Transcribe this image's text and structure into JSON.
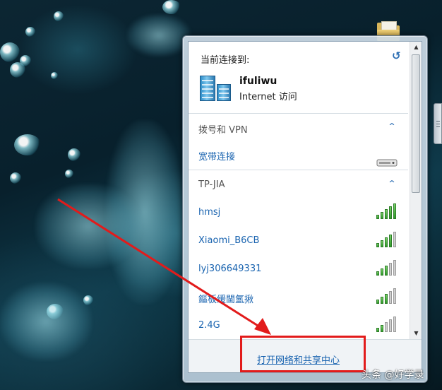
{
  "network_popup": {
    "header_label": "当前连接到:",
    "refresh_icon": "refresh-icon",
    "current": {
      "name": "ifuliwu",
      "status": "Internet 访问"
    },
    "sections": [
      {
        "title": "拨号和 VPN",
        "items": [
          {
            "name": "宽带连接",
            "icon": "modem-icon"
          }
        ]
      },
      {
        "title": "TP-JIA",
        "items": [
          {
            "name": "hmsj",
            "signal": 5
          },
          {
            "name": "Xiaomi_B6CB",
            "signal": 4
          },
          {
            "name": "lyj306649331",
            "signal": 3
          },
          {
            "name": "鏂板缓閫氳揪",
            "signal": 3
          },
          {
            "name": "2.4G",
            "signal": 2
          }
        ]
      }
    ],
    "footer_link": "打开网络和共享中心"
  },
  "watermark": "头条 @好学录",
  "colors": {
    "link": "#1a64b0",
    "highlight": "#e21b1b",
    "arrow": "#e21b1b"
  }
}
